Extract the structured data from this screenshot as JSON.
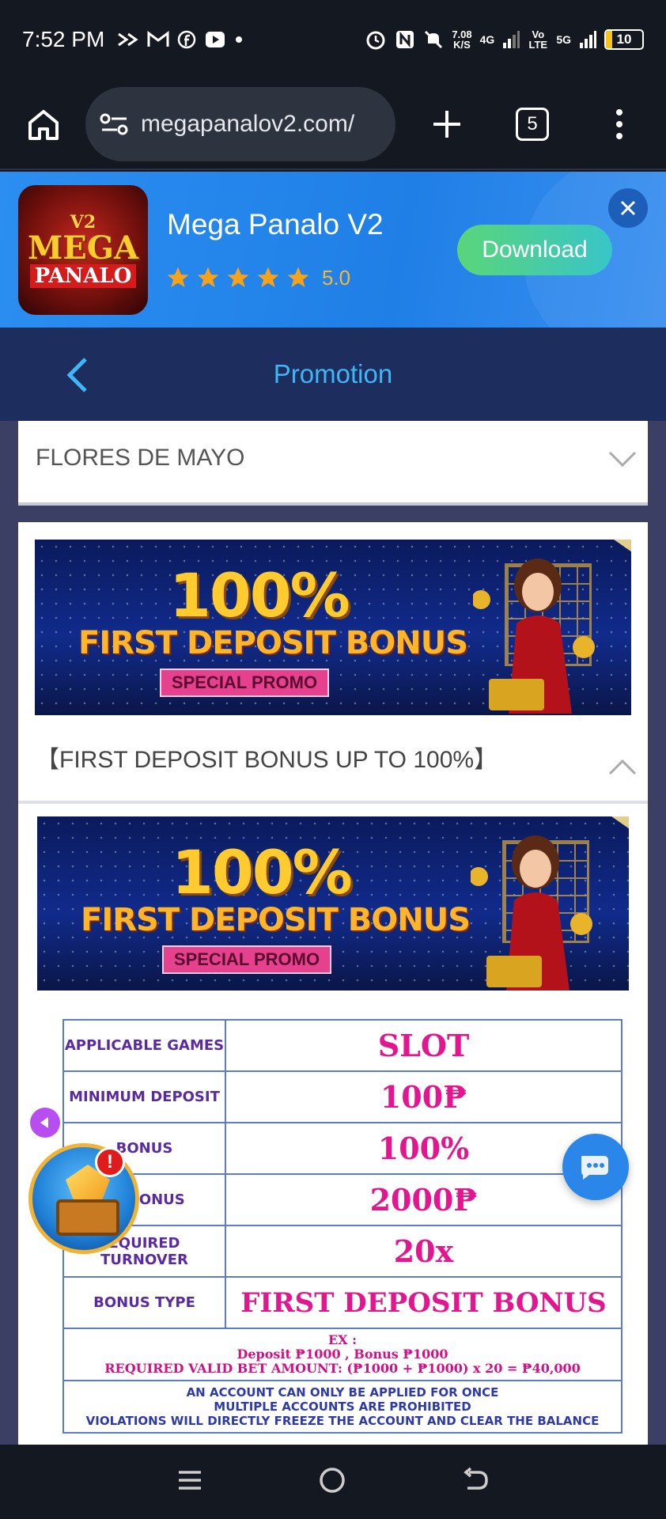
{
  "status_bar": {
    "time": "7:52 PM",
    "net_speed": "7.08",
    "net_unit": "K/S",
    "sig1": "4G",
    "sig2": "Vo LTE",
    "sig3": "5G",
    "battery": "10"
  },
  "browser": {
    "url": "megapanalov2.com/",
    "tab_count": "5"
  },
  "app_banner": {
    "logo_v2": "V2",
    "logo_line1": "MEGA",
    "logo_line2": "PANALO",
    "name": "Mega Panalo V2",
    "rating": "5.0",
    "stars": 5,
    "download_label": "Download"
  },
  "header": {
    "title": "Promotion"
  },
  "promos": {
    "collapsed_title": "FLORES DE MAYO",
    "expanded_title": "【FIRST DEPOSIT BONUS UP TO 100%】"
  },
  "banner": {
    "percent": "100%",
    "headline": "FIRST DEPOSIT BONUS",
    "tag": "SPECIAL PROMO"
  },
  "table": {
    "rows": [
      {
        "label": "APPLICABLE GAMES",
        "value": "SLOT"
      },
      {
        "label": "MINIMUM DEPOSIT",
        "value": "100₱"
      },
      {
        "label": "BONUS",
        "value": "100%"
      },
      {
        "label": "IM BONUS",
        "value": "2000₱"
      },
      {
        "label": "EQUIRED TURNOVER",
        "value": "20x"
      },
      {
        "label": "BONUS TYPE",
        "value": "FIRST DEPOSIT BONUS"
      }
    ],
    "example_line1": "EX :",
    "example_line2": "Deposit ₱1000 , Bonus ₱1000",
    "example_line3": "REQUIRED VALID BET AMOUNT: (₱1000 + ₱1000) x 20 = ₱40,000",
    "rule1": "AN ACCOUNT CAN ONLY BE APPLIED FOR ONCE",
    "rule2": "MULTIPLE ACCOUNTS ARE PROHIBITED",
    "rule3": "VIOLATIONS WILL DIRECTLY FREEZE THE ACCOUNT AND CLEAR THE BALANCE"
  },
  "floating": {
    "alert_badge": "!"
  },
  "colors": {
    "accent_blue": "#3fb6f5",
    "header_bg": "#1c2d5e",
    "value_pink": "#e3168f",
    "label_purple": "#5a2aa0"
  }
}
